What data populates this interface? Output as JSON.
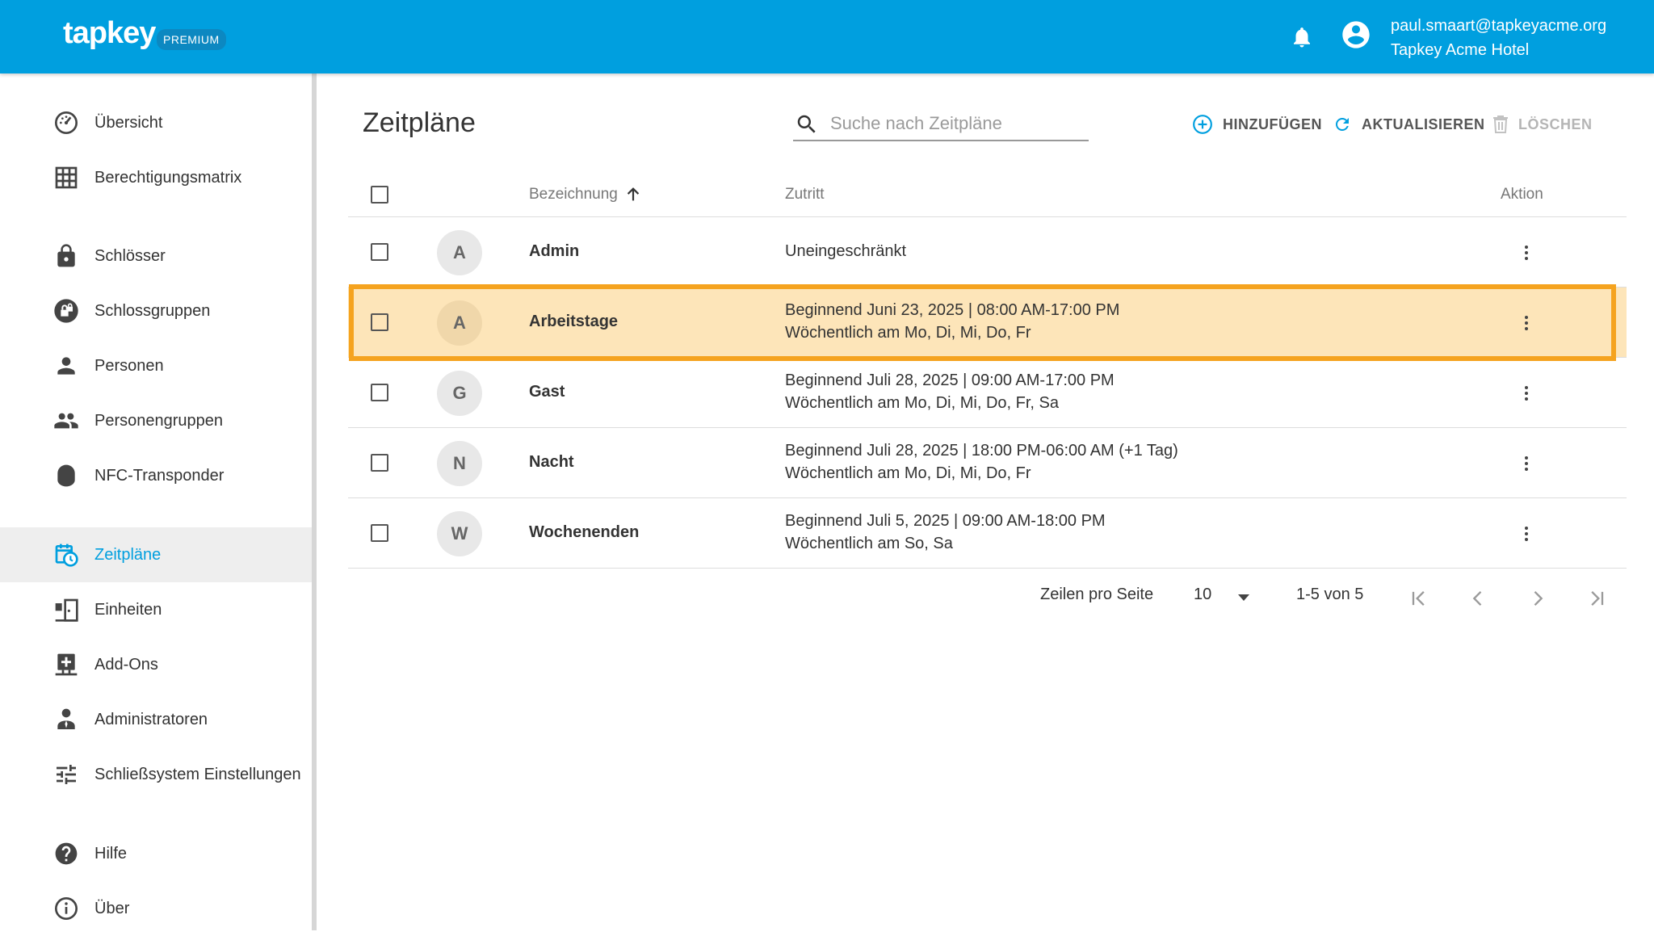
{
  "header": {
    "logo_text": "tapkey",
    "badge": "PREMIUM",
    "user_email": "paul.smaart@tapkeyacme.org",
    "organization": "Tapkey Acme Hotel",
    "icons": [
      "bell-icon",
      "account-circle-icon"
    ]
  },
  "sidebar": {
    "items": [
      {
        "label": "Übersicht",
        "icon": "dashboard-gauge-icon"
      },
      {
        "label": "Berechtigungsmatrix",
        "icon": "grid-icon"
      },
      {
        "label": "Schlösser",
        "icon": "lock-icon"
      },
      {
        "label": "Schlossgruppen",
        "icon": "lock-group-icon"
      },
      {
        "label": "Personen",
        "icon": "person-icon"
      },
      {
        "label": "Personengruppen",
        "icon": "people-icon"
      },
      {
        "label": "NFC-Transponder",
        "icon": "nfc-tag-icon"
      },
      {
        "label": "Zeitpläne",
        "icon": "calendar-clock-icon",
        "active": true
      },
      {
        "label": "Einheiten",
        "icon": "units-icon"
      },
      {
        "label": "Add-Ons",
        "icon": "add-ons-icon"
      },
      {
        "label": "Administratoren",
        "icon": "admin-icon"
      },
      {
        "label": "Schließsystem Einstellungen",
        "icon": "tune-sliders-icon"
      },
      {
        "label": "Hilfe",
        "icon": "help-icon"
      },
      {
        "label": "Über",
        "icon": "info-icon"
      }
    ]
  },
  "main": {
    "title": "Zeitpläne",
    "search_placeholder": "Suche nach Zeitpläne",
    "toolbar": {
      "add": "HINZUFÜGEN",
      "refresh": "AKTUALISIEREN",
      "delete": "LÖSCHEN"
    },
    "table": {
      "columns": {
        "name": "Bezeichnung",
        "access": "Zutritt",
        "action": "Aktion"
      },
      "sort": "ascending",
      "rows": [
        {
          "initial": "A",
          "name": "Admin",
          "line1": "Uneingeschränkt",
          "line2": ""
        },
        {
          "initial": "A",
          "name": "Arbeitstage",
          "line1": "Beginnend Juni 23, 2025 | 08:00 AM-17:00 PM",
          "line2": "Wöchentlich am Mo, Di, Mi, Do, Fr",
          "highlighted": true
        },
        {
          "initial": "G",
          "name": "Gast",
          "line1": "Beginnend Juli 28, 2025 | 09:00 AM-17:00 PM",
          "line2": "Wöchentlich am Mo, Di, Mi, Do, Fr, Sa"
        },
        {
          "initial": "N",
          "name": "Nacht",
          "line1": "Beginnend Juli 28, 2025 | 18:00 PM-06:00 AM (+1 Tag)",
          "line2": "Wöchentlich am Mo, Di, Mi, Do, Fr"
        },
        {
          "initial": "W",
          "name": "Wochenenden",
          "line1": "Beginnend Juli 5, 2025 | 09:00 AM-18:00 PM",
          "line2": "Wöchentlich am So, Sa"
        }
      ]
    },
    "pagination": {
      "rows_per_page_label": "Zeilen pro Seite",
      "rows_per_page": "10",
      "range": "1-5 von 5"
    }
  },
  "colors": {
    "brand": "#009fdf",
    "highlight_fill": "#fde5b9",
    "highlight_border": "#f5a31f"
  }
}
